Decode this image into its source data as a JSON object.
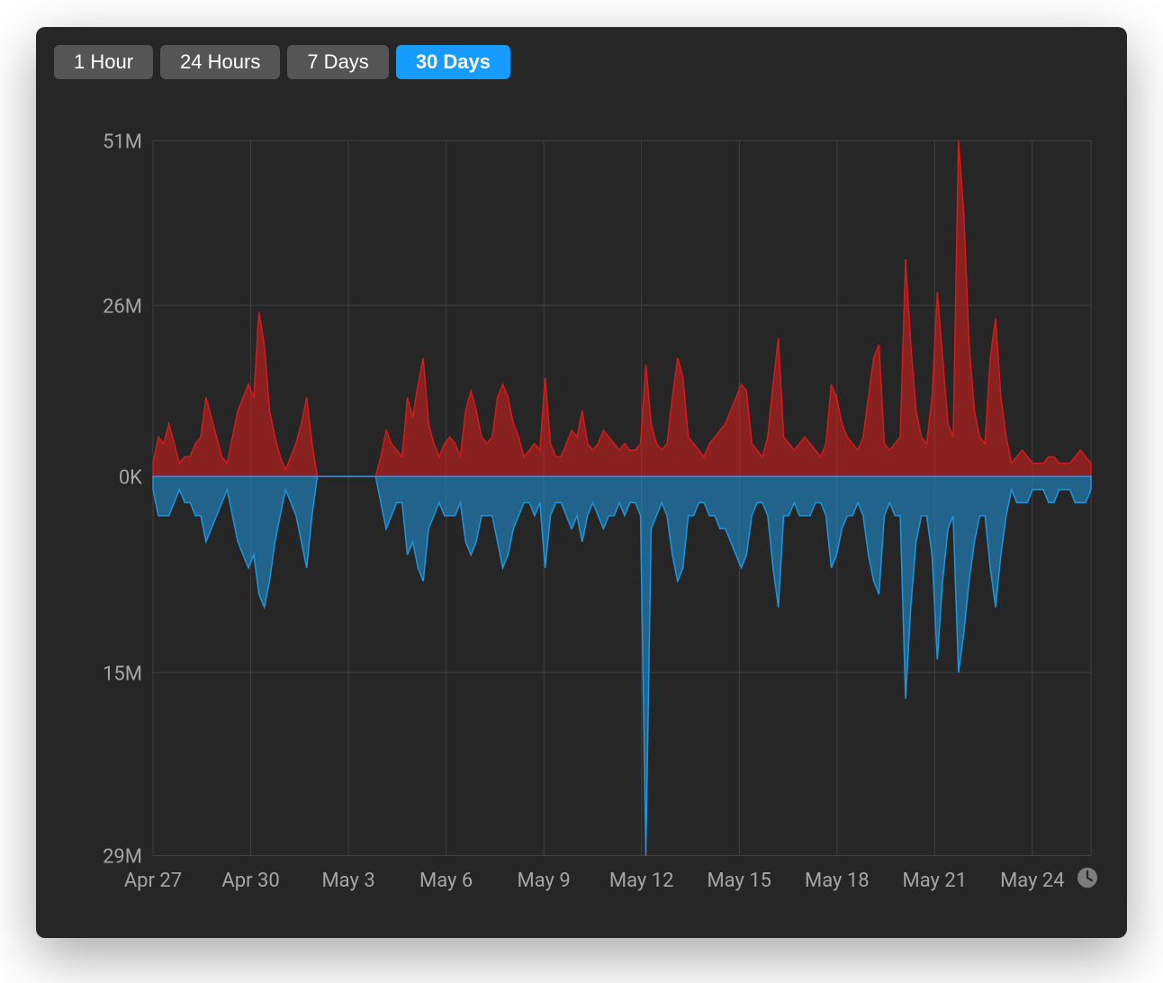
{
  "tabs": [
    {
      "label": "1 Hour",
      "active": false
    },
    {
      "label": "24 Hours",
      "active": false
    },
    {
      "label": "7 Days",
      "active": false
    },
    {
      "label": "30 Days",
      "active": true
    }
  ],
  "chart_data": {
    "type": "area",
    "title": "",
    "xlabel": "",
    "ylabel": "",
    "x_tick_labels": [
      "Apr 27",
      "Apr 30",
      "May 3",
      "May 6",
      "May 9",
      "May 12",
      "May 15",
      "May 18",
      "May 21",
      "May 24"
    ],
    "y_tick_labels_up": [
      "0K",
      "26M",
      "51M"
    ],
    "y_tick_labels_down": [
      "15M",
      "29M"
    ],
    "ylim_up": [
      0,
      51
    ],
    "ylim_down": [
      0,
      29
    ],
    "colors": {
      "up": "#d21c1c",
      "down": "#1e96dc",
      "bg": "#262626",
      "grid": "#404040",
      "accent": "#169cff"
    },
    "series": [
      {
        "name": "up",
        "direction": "up",
        "values": [
          2,
          6,
          5,
          8,
          5,
          2,
          3,
          3,
          5,
          6,
          12,
          9,
          6,
          3,
          2,
          6,
          10,
          12,
          14,
          12,
          25,
          20,
          10,
          6,
          3,
          1,
          3,
          5,
          8,
          12,
          5,
          0,
          0,
          0,
          0,
          0,
          0,
          0,
          0,
          0,
          0,
          0,
          0,
          3,
          7,
          5,
          4,
          3,
          12,
          9,
          14,
          18,
          8,
          5,
          3,
          5,
          6,
          5,
          3,
          10,
          13,
          10,
          6,
          5,
          6,
          12,
          14,
          12,
          8,
          6,
          3,
          4,
          5,
          4,
          15,
          5,
          3,
          3,
          5,
          7,
          6,
          10,
          5,
          4,
          5,
          7,
          6,
          5,
          4,
          5,
          4,
          4,
          5,
          17,
          8,
          5,
          4,
          5,
          12,
          18,
          15,
          6,
          5,
          4,
          3,
          5,
          6,
          7,
          8,
          10,
          12,
          14,
          13,
          5,
          4,
          3,
          6,
          14,
          21,
          6,
          5,
          4,
          5,
          6,
          5,
          4,
          3,
          5,
          14,
          12,
          8,
          6,
          5,
          4,
          6,
          12,
          18,
          20,
          5,
          4,
          5,
          6,
          33,
          20,
          10,
          6,
          5,
          12,
          28,
          18,
          8,
          6,
          51,
          40,
          20,
          10,
          6,
          5,
          18,
          24,
          12,
          6,
          2,
          3,
          4,
          3,
          2,
          2,
          2,
          3,
          3,
          2,
          2,
          2,
          3,
          4,
          3,
          2
        ]
      },
      {
        "name": "down",
        "direction": "down",
        "values": [
          1,
          3,
          3,
          3,
          2,
          1,
          2,
          2,
          3,
          3,
          5,
          4,
          3,
          2,
          1,
          3,
          5,
          6,
          7,
          6,
          9,
          10,
          8,
          5,
          3,
          1,
          2,
          3,
          5,
          7,
          3,
          0,
          0,
          0,
          0,
          0,
          0,
          0,
          0,
          0,
          0,
          0,
          0,
          2,
          4,
          3,
          2,
          2,
          6,
          5,
          7,
          8,
          4,
          3,
          2,
          3,
          3,
          3,
          2,
          5,
          6,
          5,
          3,
          3,
          3,
          5,
          7,
          6,
          4,
          3,
          2,
          2,
          3,
          2,
          7,
          3,
          2,
          2,
          3,
          4,
          3,
          5,
          3,
          2,
          3,
          4,
          3,
          3,
          2,
          3,
          2,
          2,
          3,
          29,
          4,
          3,
          2,
          3,
          6,
          8,
          7,
          3,
          3,
          2,
          2,
          3,
          3,
          4,
          4,
          5,
          6,
          7,
          6,
          3,
          2,
          2,
          3,
          7,
          10,
          3,
          3,
          2,
          3,
          3,
          3,
          2,
          2,
          3,
          7,
          6,
          4,
          3,
          3,
          2,
          3,
          6,
          8,
          9,
          3,
          2,
          3,
          3,
          17,
          10,
          5,
          3,
          3,
          6,
          14,
          8,
          4,
          3,
          15,
          12,
          8,
          5,
          3,
          3,
          7,
          10,
          6,
          3,
          1,
          2,
          2,
          2,
          1,
          1,
          1,
          2,
          2,
          1,
          1,
          1,
          2,
          2,
          2,
          1
        ]
      }
    ]
  }
}
